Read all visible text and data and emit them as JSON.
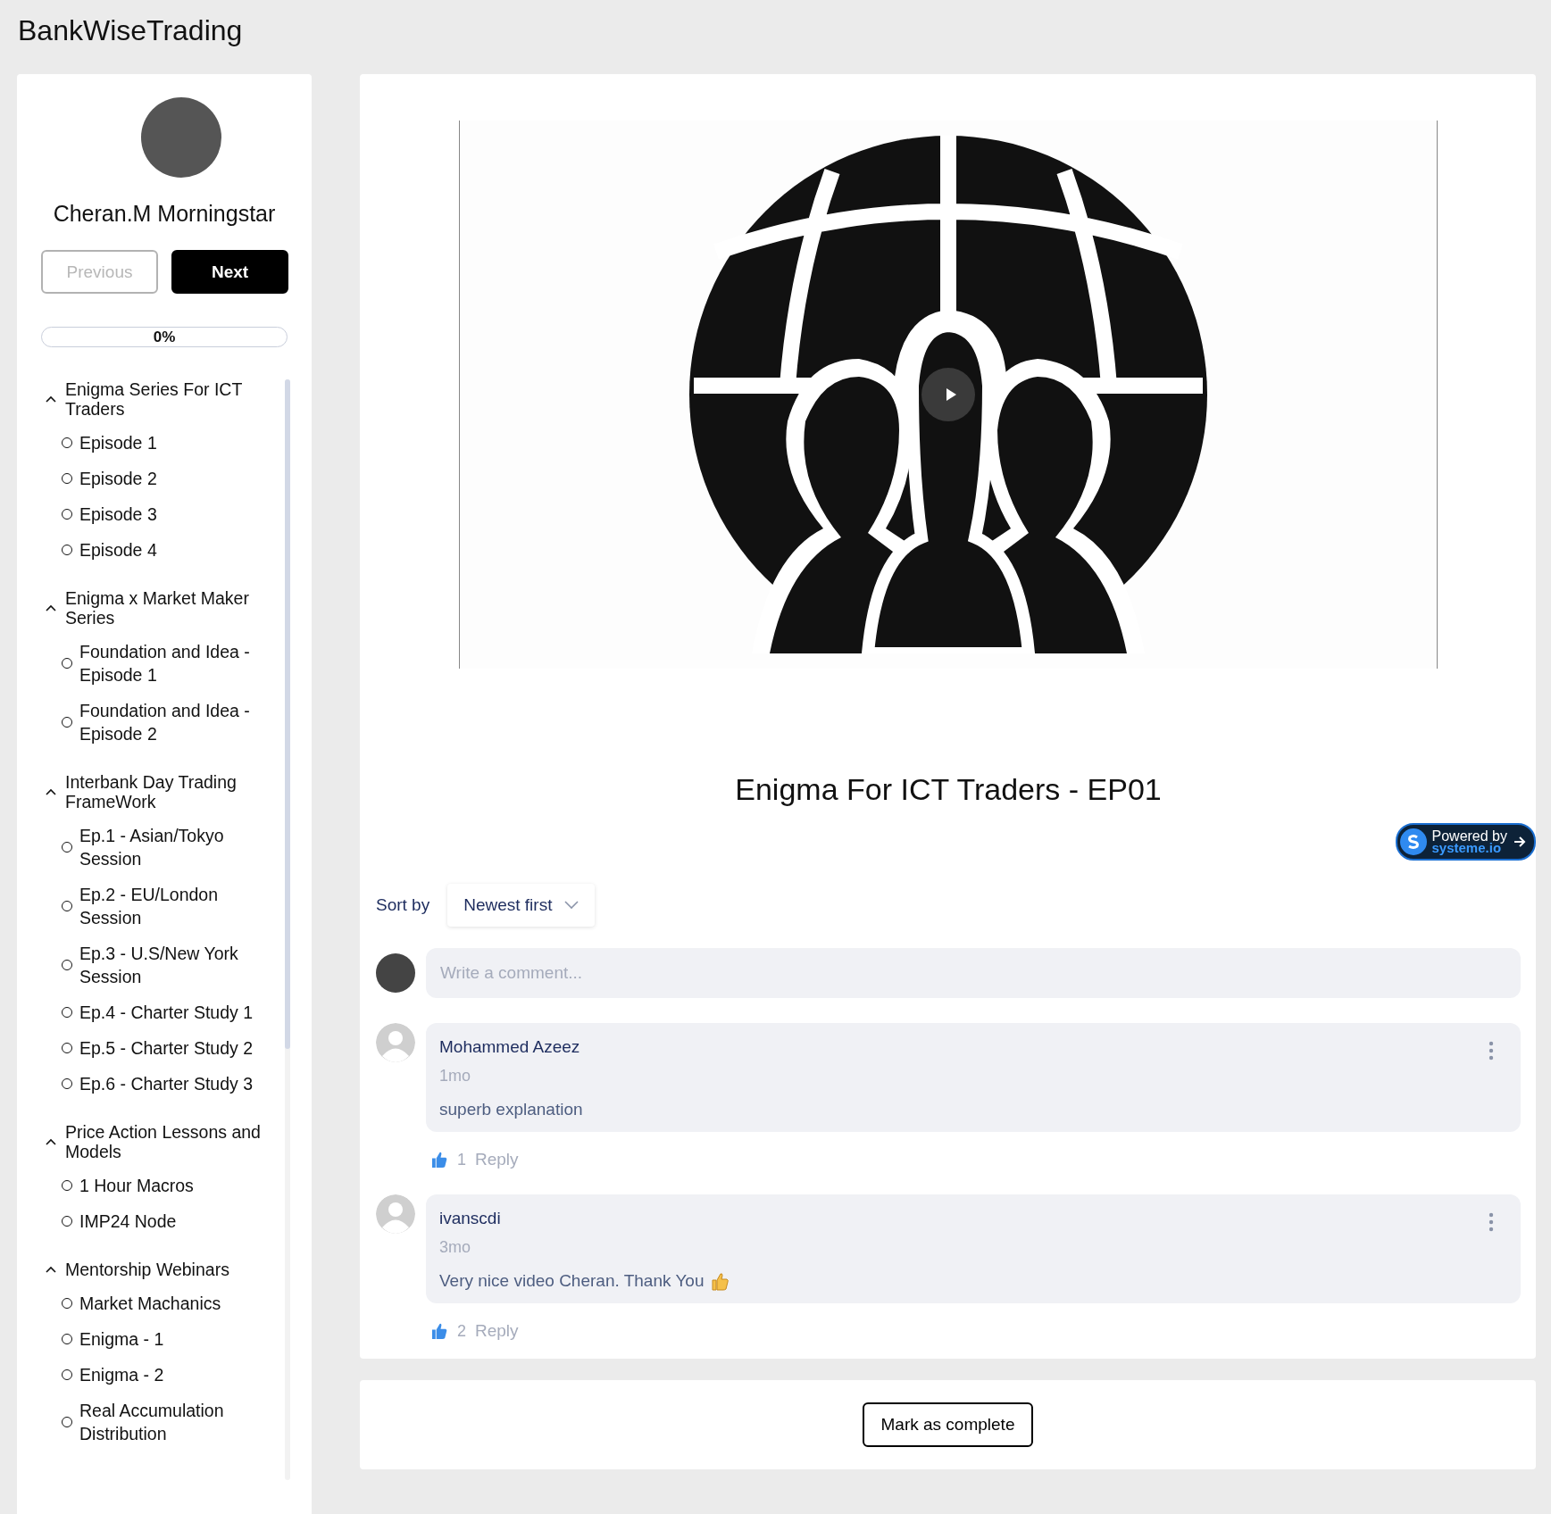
{
  "header": {
    "title": "BankWiseTrading"
  },
  "sidebar": {
    "profile_name": "Cheran.M Morningstar",
    "previous": {
      "label": "Previous",
      "disabled": true
    },
    "next": {
      "label": "Next",
      "disabled": false
    },
    "progress": {
      "level": 0,
      "reading": "0%"
    },
    "sections": [
      {
        "title": "Enigma Series For ICT Traders",
        "expanded": true,
        "lessons": [
          {
            "title": "Episode 1",
            "completed": false
          },
          {
            "title": "Episode 2",
            "completed": false
          },
          {
            "title": "Episode 3",
            "completed": false
          },
          {
            "title": "Episode 4",
            "completed": false
          }
        ]
      },
      {
        "title": "Enigma x Market Maker Series",
        "expanded": true,
        "lessons": [
          {
            "title": "Foundation and Idea - Episode 1",
            "completed": false
          },
          {
            "title": "Foundation and Idea - Episode 2",
            "completed": false
          }
        ]
      },
      {
        "title": "Interbank Day Trading FrameWork",
        "expanded": true,
        "lessons": [
          {
            "title": "Ep.1 - Asian/Tokyo Session",
            "completed": false
          },
          {
            "title": "Ep.2 - EU/London Session",
            "completed": false
          },
          {
            "title": "Ep.3 - U.S/New York Session",
            "completed": false
          },
          {
            "title": "Ep.4 - Charter Study 1",
            "completed": false
          },
          {
            "title": "Ep.5 - Charter Study 2",
            "completed": false
          },
          {
            "title": "Ep.6 - Charter Study 3",
            "completed": false
          }
        ]
      },
      {
        "title": "Price Action Lessons and Models",
        "expanded": true,
        "lessons": [
          {
            "title": "1 Hour Macros",
            "completed": false
          },
          {
            "title": "IMP24 Node",
            "completed": false
          }
        ]
      },
      {
        "title": "Mentorship Webinars",
        "expanded": true,
        "lessons": [
          {
            "title": "Market Machanics",
            "completed": false
          },
          {
            "title": "Enigma - 1",
            "completed": false
          },
          {
            "title": "Enigma - 2",
            "completed": false
          },
          {
            "title": "Real Accumulation Distribution",
            "completed": false
          }
        ]
      }
    ]
  },
  "lesson": {
    "title": "Enigma For ICT Traders - EP01"
  },
  "badge": {
    "line1": "Powered by",
    "line2": "systeme.io"
  },
  "comments": {
    "sort_label": "Sort by",
    "sort_value": "Newest first",
    "input": {
      "placeholder": "Write a comment..."
    },
    "items": [
      {
        "author": "Mohammed Azeez",
        "time": "1mo",
        "text": "superb explanation",
        "emoji": false,
        "likes": "1",
        "reply": "Reply"
      },
      {
        "author": "ivanscdi",
        "time": "3mo",
        "text": "Very nice video Cheran. Thank You",
        "emoji": true,
        "likes": "2",
        "reply": "Reply"
      }
    ]
  },
  "footer": {
    "button": "Mark as complete"
  }
}
